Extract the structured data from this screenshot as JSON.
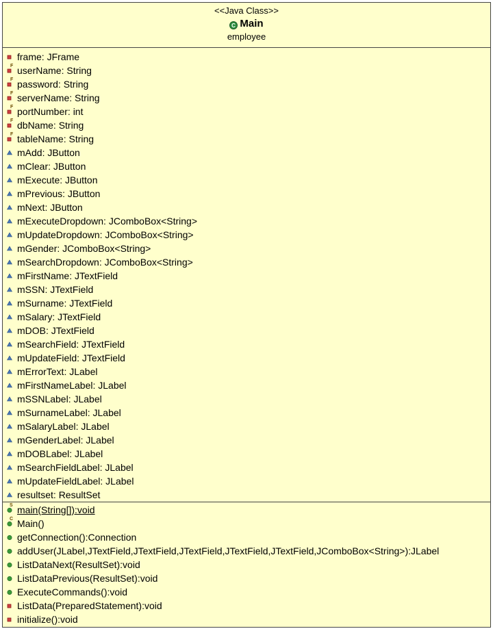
{
  "class_box": {
    "stereotype": "<<Java Class>>",
    "name": "Main",
    "package": "employee"
  },
  "colors": {
    "box_fill": "#ffffcc",
    "border": "#444444",
    "private_icon": "#d04040",
    "package_icon": "#4a78b8",
    "public_icon": "#3a9a3a",
    "class_icon": "#2f8f3f"
  },
  "fields": [
    {
      "text": "frame: JFrame",
      "visibility": "private",
      "final": false
    },
    {
      "text": "userName: String",
      "visibility": "private",
      "final": true
    },
    {
      "text": "password: String",
      "visibility": "private",
      "final": true
    },
    {
      "text": "serverName: String",
      "visibility": "private",
      "final": true
    },
    {
      "text": "portNumber: int",
      "visibility": "private",
      "final": true
    },
    {
      "text": "dbName: String",
      "visibility": "private",
      "final": true
    },
    {
      "text": "tableName: String",
      "visibility": "private",
      "final": true
    },
    {
      "text": "mAdd: JButton",
      "visibility": "package",
      "final": false
    },
    {
      "text": "mClear: JButton",
      "visibility": "package",
      "final": false
    },
    {
      "text": "mExecute: JButton",
      "visibility": "package",
      "final": false
    },
    {
      "text": "mPrevious: JButton",
      "visibility": "package",
      "final": false
    },
    {
      "text": "mNext: JButton",
      "visibility": "package",
      "final": false
    },
    {
      "text": "mExecuteDropdown: JComboBox<String>",
      "visibility": "package",
      "final": false
    },
    {
      "text": "mUpdateDropdown: JComboBox<String>",
      "visibility": "package",
      "final": false
    },
    {
      "text": "mGender: JComboBox<String>",
      "visibility": "package",
      "final": false
    },
    {
      "text": "mSearchDropdown: JComboBox<String>",
      "visibility": "package",
      "final": false
    },
    {
      "text": "mFirstName: JTextField",
      "visibility": "package",
      "final": false
    },
    {
      "text": "mSSN: JTextField",
      "visibility": "package",
      "final": false
    },
    {
      "text": "mSurname: JTextField",
      "visibility": "package",
      "final": false
    },
    {
      "text": "mSalary: JTextField",
      "visibility": "package",
      "final": false
    },
    {
      "text": "mDOB: JTextField",
      "visibility": "package",
      "final": false
    },
    {
      "text": "mSearchField: JTextField",
      "visibility": "package",
      "final": false
    },
    {
      "text": "mUpdateField: JTextField",
      "visibility": "package",
      "final": false
    },
    {
      "text": "mErrorText: JLabel",
      "visibility": "package",
      "final": false
    },
    {
      "text": "mFirstNameLabel: JLabel",
      "visibility": "package",
      "final": false
    },
    {
      "text": "mSSNLabel: JLabel",
      "visibility": "package",
      "final": false
    },
    {
      "text": "mSurnameLabel: JLabel",
      "visibility": "package",
      "final": false
    },
    {
      "text": "mSalaryLabel: JLabel",
      "visibility": "package",
      "final": false
    },
    {
      "text": "mGenderLabel: JLabel",
      "visibility": "package",
      "final": false
    },
    {
      "text": "mDOBLabel: JLabel",
      "visibility": "package",
      "final": false
    },
    {
      "text": "mSearchFieldLabel: JLabel",
      "visibility": "package",
      "final": false
    },
    {
      "text": "mUpdateFieldLabel: JLabel",
      "visibility": "package",
      "final": false
    },
    {
      "text": "resultset: ResultSet",
      "visibility": "package",
      "final": false
    }
  ],
  "methods": [
    {
      "text": "main(String[]):void",
      "visibility": "public",
      "static": true,
      "constructor": false
    },
    {
      "text": "Main()",
      "visibility": "public",
      "static": false,
      "constructor": true
    },
    {
      "text": "getConnection():Connection",
      "visibility": "public",
      "static": false,
      "constructor": false
    },
    {
      "text": "addUser(JLabel,JTextField,JTextField,JTextField,JTextField,JTextField,JComboBox<String>):JLabel",
      "visibility": "public",
      "static": false,
      "constructor": false
    },
    {
      "text": "ListDataNext(ResultSet):void",
      "visibility": "public",
      "static": false,
      "constructor": false
    },
    {
      "text": "ListDataPrevious(ResultSet):void",
      "visibility": "public",
      "static": false,
      "constructor": false
    },
    {
      "text": "ExecuteCommands():void",
      "visibility": "public",
      "static": false,
      "constructor": false
    },
    {
      "text": "ListData(PreparedStatement):void",
      "visibility": "private",
      "static": false,
      "constructor": false
    },
    {
      "text": "initialize():void",
      "visibility": "private",
      "static": false,
      "constructor": false
    }
  ]
}
